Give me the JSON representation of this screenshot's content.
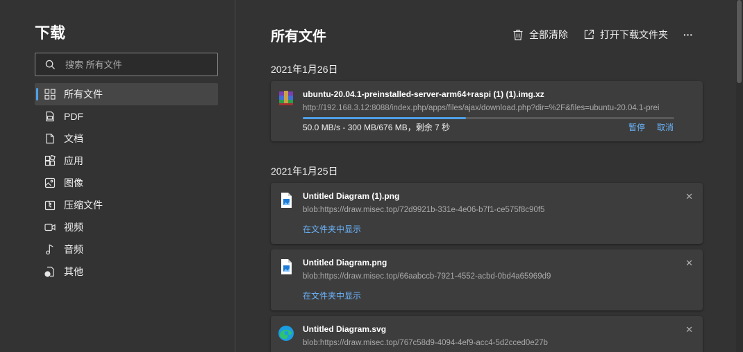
{
  "sidebar": {
    "title": "下载",
    "search_placeholder": "搜索 所有文件",
    "items": [
      {
        "label": "所有文件",
        "icon": "grid-icon",
        "active": true
      },
      {
        "label": "PDF",
        "icon": "pdf-icon"
      },
      {
        "label": "文档",
        "icon": "document-icon"
      },
      {
        "label": "应用",
        "icon": "apps-icon"
      },
      {
        "label": "图像",
        "icon": "image-icon"
      },
      {
        "label": "压缩文件",
        "icon": "archive-icon"
      },
      {
        "label": "视频",
        "icon": "video-icon"
      },
      {
        "label": "音频",
        "icon": "audio-icon"
      },
      {
        "label": "其他",
        "icon": "other-icon"
      }
    ]
  },
  "header": {
    "title": "所有文件",
    "clear_all": "全部清除",
    "open_folder": "打开下载文件夹",
    "more": "···"
  },
  "groups": [
    {
      "date": "2021年1月26日",
      "items": [
        {
          "name": "ubuntu-20.04.1-preinstalled-server-arm64+raspi (1) (1).img.xz",
          "url": "http://192.168.3.12:8088/index.php/apps/files/ajax/download.php?dir=%2F&files=ubuntu-20.04.1-prei",
          "status": "50.0 MB/s - 300 MB/676 MB，剩余 7 秒",
          "progress": 0.44,
          "pause": "暂停",
          "cancel": "取消",
          "icon": "archive-rar-icon"
        }
      ]
    },
    {
      "date": "2021年1月25日",
      "items": [
        {
          "name": "Untitled Diagram (1).png",
          "url": "blob:https://draw.misec.top/72d9921b-331e-4e06-b7f1-ce575f8c90f5",
          "link": "在文件夹中显示",
          "icon": "image-file-icon"
        },
        {
          "name": "Untitled Diagram.png",
          "url": "blob:https://draw.misec.top/66aabccb-7921-4552-acbd-0bd4a65969d9",
          "link": "在文件夹中显示",
          "icon": "image-file-icon"
        },
        {
          "name": "Untitled Diagram.svg",
          "url": "blob:https://draw.misec.top/767c58d9-4094-4ef9-acc4-5d2cced0e27b",
          "icon": "edge-icon"
        }
      ]
    }
  ],
  "colors": {
    "accent": "#4ea0e8",
    "link": "#6cb6ff",
    "background": "#333333",
    "card": "#3d3d3d"
  }
}
